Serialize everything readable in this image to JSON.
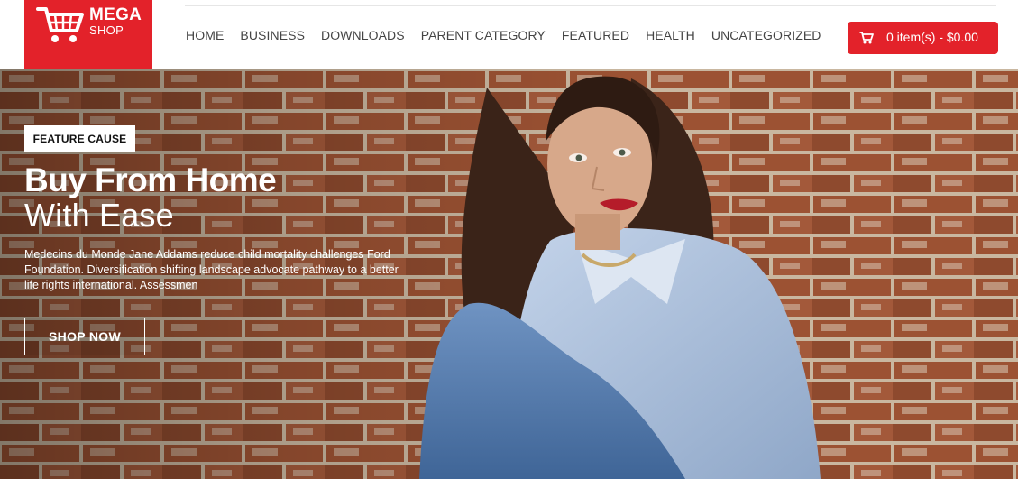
{
  "header": {
    "logo": {
      "line1": "MEGA",
      "line2": "SHOP"
    },
    "nav": [
      "HOME",
      "BUSINESS",
      "DOWNLOADS",
      "PARENT CATEGORY",
      "FEATURED",
      "HEALTH",
      "UNCATEGORIZED"
    ],
    "cart": {
      "label": "0 item(s) - $0.00"
    }
  },
  "hero": {
    "badge": "FEATURE CAUSE",
    "title": "Buy From Home",
    "subtitle": "With Ease",
    "description": "Medecins du Monde Jane Addams reduce child mortality challenges Ford Foundation. Diversification shifting landscape advocate pathway to a better life rights international. Assessmen",
    "button": "SHOP NOW"
  },
  "colors": {
    "brand": "#e3222a",
    "text": "#444444"
  },
  "icons": {
    "logo": "shopping-cart-icon",
    "cart": "shopping-cart-icon"
  }
}
